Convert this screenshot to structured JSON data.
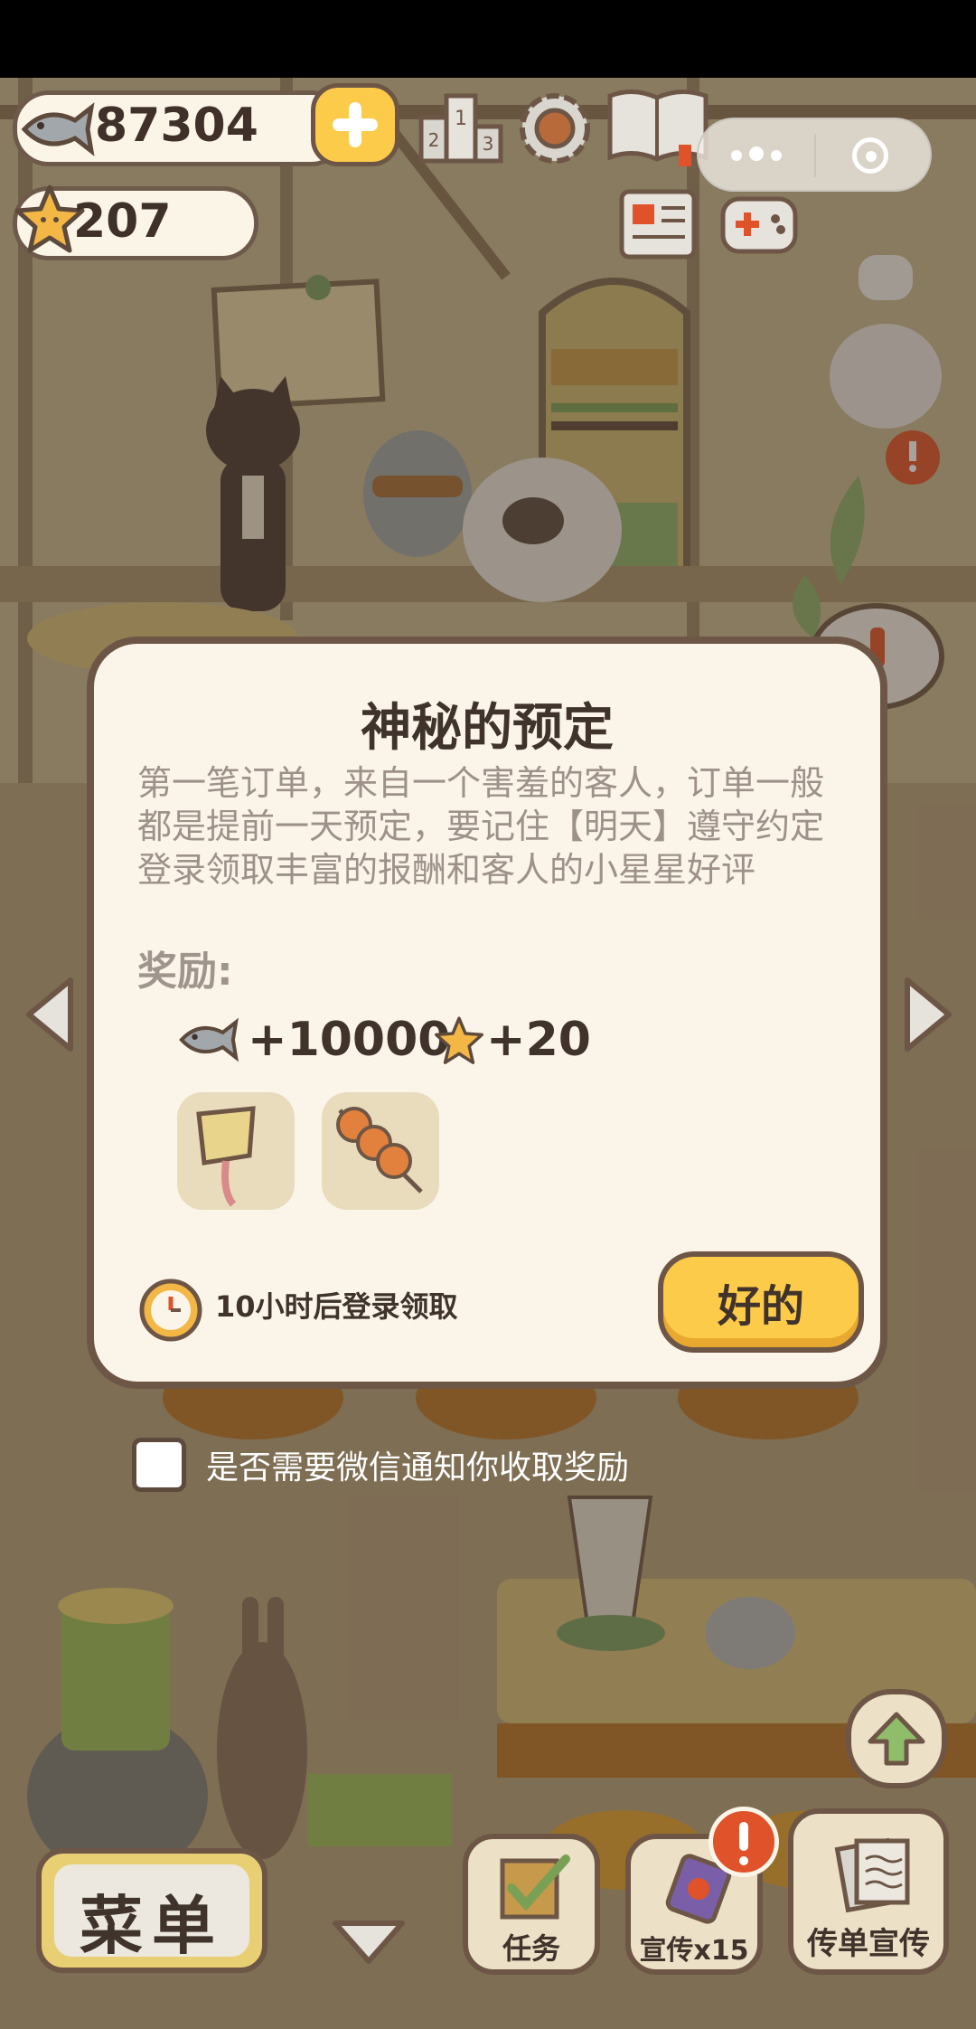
{
  "top_bar": {
    "fish_count": "87304",
    "star_count": "207",
    "icons": [
      "fish-icon",
      "plus-icon",
      "leaderboard-icon",
      "settings-gear-icon",
      "recipe-book-icon",
      "newspaper-icon",
      "gamepad-icon",
      "more-dots-icon",
      "record-icon"
    ]
  },
  "dialog": {
    "title": "神秘的预定",
    "description_lines": [
      "第一笔订单，来自一个害羞的客人，订单一般",
      "都是提前一天预定，要记住【明天】遵守约定",
      "登录领取丰富的报酬和客人的小星星好评"
    ],
    "reward_label": "奖励:",
    "fish_reward": "+10000",
    "star_reward": "+20",
    "reward_items": [
      "sign-board-icon",
      "skewer-icon"
    ],
    "timer_text": "10小时后登录领取",
    "ok_label": "好的"
  },
  "notify": {
    "checked": false,
    "label": "是否需要微信通知你收取奖励"
  },
  "bottom_bar": {
    "menu_label": "菜单",
    "task_label": "任务",
    "promo_label": "宣传x15",
    "flyer_label": "传单宣传"
  },
  "colors": {
    "background": "#b9a581",
    "dialog_bg": "#fbf5e9",
    "accent_yellow": "#fdcb4a",
    "alert_orange": "#e0522a",
    "outline_brown": "#6d5646"
  }
}
